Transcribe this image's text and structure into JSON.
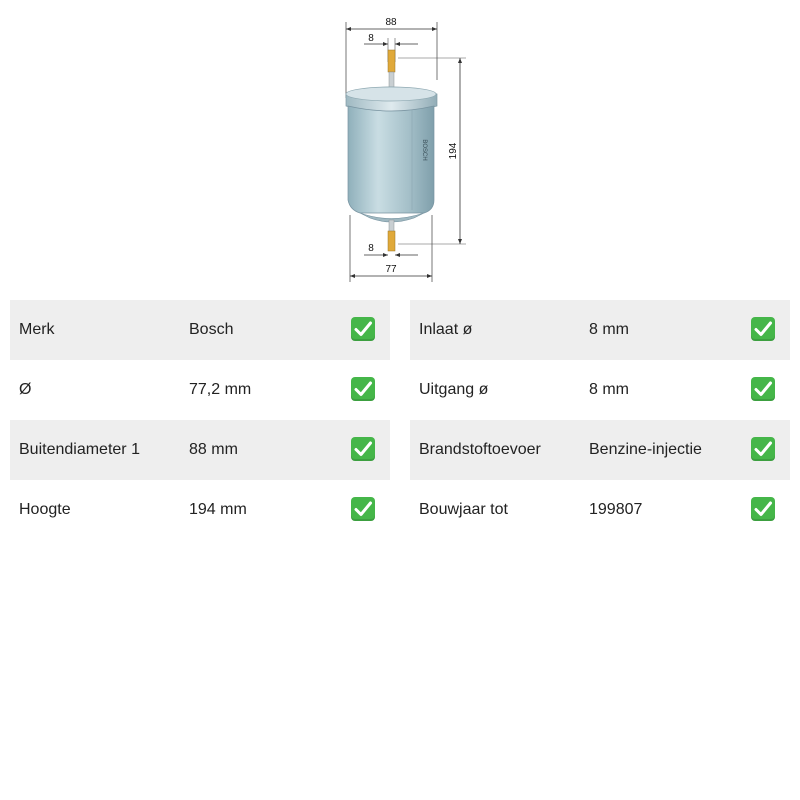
{
  "dimensions": {
    "top_width": "88",
    "top_pipe": "8",
    "height": "194",
    "bottom_pipe": "8",
    "bottom_width": "77"
  },
  "product_brand_marking": "BOSCH",
  "specs_left": [
    {
      "label": "Merk",
      "value": "Bosch",
      "icon": "check-icon"
    },
    {
      "label": "Ø",
      "value": "77,2 mm",
      "icon": "check-icon"
    },
    {
      "label": "Buitendiameter 1",
      "value": "88 mm",
      "icon": "check-icon"
    },
    {
      "label": "Hoogte",
      "value": "194 mm",
      "icon": "check-icon"
    }
  ],
  "specs_right": [
    {
      "label": "Inlaat ø",
      "value": "8 mm",
      "icon": "check-icon"
    },
    {
      "label": "Uitgang ø",
      "value": "8 mm",
      "icon": "check-icon"
    },
    {
      "label": "Brandstoftoevoer",
      "value": "Benzine-injectie",
      "icon": "check-icon"
    },
    {
      "label": "Bouwjaar tot",
      "value": "199807",
      "icon": "check-icon"
    }
  ],
  "colors": {
    "row_shade": "#eeeeee",
    "check_green": "#45b649",
    "filter_body": "#a9c3cc",
    "pipe_orange": "#e0a93a"
  }
}
